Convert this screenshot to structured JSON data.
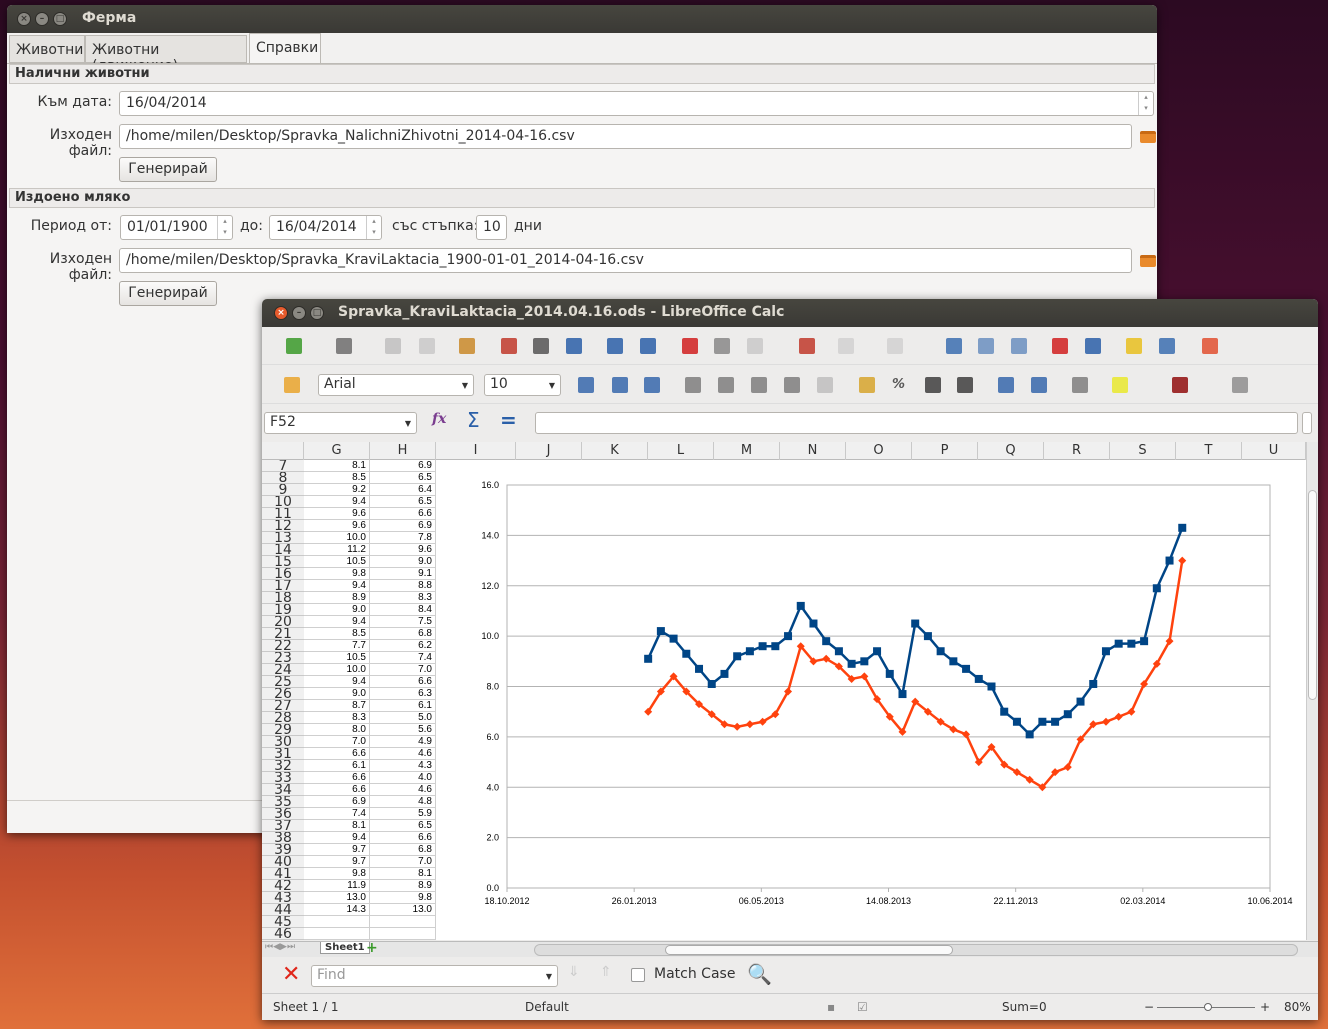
{
  "ferma": {
    "title": "Ферма",
    "tabs": [
      {
        "label": "Животни"
      },
      {
        "label": "Животни (движение)"
      },
      {
        "label": "Справки",
        "active": true
      }
    ],
    "available": {
      "header": "Налични животни",
      "date_label": "Към дата:",
      "date_value": "16/04/2014",
      "file_label": "Изходен файл:",
      "file_value": "/home/milen/Desktop/Spravka_NalichniZhivotni_2014-04-16.csv",
      "generate_label": "Генерирай"
    },
    "milk": {
      "header": "Издоено мляко",
      "period_label": "Период  от:",
      "from_value": "01/01/1900",
      "to_label": "до:",
      "to_value": "16/04/2014",
      "step_label": "със стъпка:",
      "step_value": "10",
      "days_label": "дни",
      "file_label": "Изходен файл:",
      "file_value": "/home/milen/Desktop/Spravka_KraviLaktacia_1900-01-01_2014-04-16.csv",
      "generate_label": "Генерирай"
    }
  },
  "calc": {
    "title": "Spravka_KraviLaktacia_2014.04.16.ods - LibreOffice Calc",
    "toolbar1_icons": [
      "new-spreadsheet-icon",
      "open-folder-icon",
      "save-icon",
      "email-icon",
      "edit-mode-icon",
      "export-pdf-icon",
      "print-icon",
      "print-preview-icon",
      "spellcheck-icon",
      "autospellcheck-icon",
      "cut-icon",
      "copy-icon",
      "paste-icon",
      "clone-formatting-icon",
      "undo-icon",
      "redo-icon",
      "hyperlink-icon",
      "sort-ascending-icon",
      "sort-descending-icon",
      "insert-chart-icon",
      "show-draw-functions-icon",
      "navigator-icon",
      "gallery-icon",
      "help-icon"
    ],
    "toolbar2_icons": [
      "styles-icon",
      "bold-icon",
      "italic-icon",
      "underline-icon",
      "align-left-icon",
      "align-center-icon",
      "align-right-icon",
      "justify-icon",
      "merge-cells-icon",
      "currency-icon",
      "percent-icon",
      "add-decimal-icon",
      "delete-decimal-icon",
      "decrease-indent-icon",
      "increase-indent-icon",
      "borders-icon",
      "background-color-icon",
      "font-color-icon",
      "toggle-grid-icon"
    ],
    "font_name": "Arial",
    "font_size": "10",
    "percent_label": "%",
    "name_box": "F52",
    "formula_value": "",
    "columns": [
      "G",
      "H",
      "I",
      "J",
      "K",
      "L",
      "M",
      "N",
      "O",
      "P",
      "Q",
      "R",
      "S",
      "T",
      "U"
    ],
    "rows": [
      7,
      8,
      9,
      10,
      11,
      12,
      13,
      14,
      15,
      16,
      17,
      18,
      19,
      20,
      21,
      22,
      23,
      24,
      25,
      26,
      27,
      28,
      29,
      30,
      31,
      32,
      33,
      34,
      35,
      36,
      37,
      38,
      39,
      40,
      41,
      42,
      43,
      44,
      45,
      46
    ],
    "col_g": [
      "8.1",
      "8.5",
      "9.2",
      "9.4",
      "9.6",
      "9.6",
      "10.0",
      "11.2",
      "10.5",
      "9.8",
      "9.4",
      "8.9",
      "9.0",
      "9.4",
      "8.5",
      "7.7",
      "10.5",
      "10.0",
      "9.4",
      "9.0",
      "8.7",
      "8.3",
      "8.0",
      "7.0",
      "6.6",
      "6.1",
      "6.6",
      "6.6",
      "6.9",
      "7.4",
      "8.1",
      "9.4",
      "9.7",
      "9.7",
      "9.8",
      "11.9",
      "13.0",
      "14.3"
    ],
    "col_h": [
      "6.9",
      "6.5",
      "6.4",
      "6.5",
      "6.6",
      "6.9",
      "7.8",
      "9.6",
      "9.0",
      "9.1",
      "8.8",
      "8.3",
      "8.4",
      "7.5",
      "6.8",
      "6.2",
      "7.4",
      "7.0",
      "6.6",
      "6.3",
      "6.1",
      "5.0",
      "5.6",
      "4.9",
      "4.6",
      "4.3",
      "4.0",
      "4.6",
      "4.8",
      "5.9",
      "6.5",
      "6.6",
      "6.8",
      "7.0",
      "8.1",
      "8.9",
      "9.8",
      "13.0"
    ],
    "sheet_tab": "Sheet1",
    "find_placeholder": "Find",
    "match_case_label": "Match Case",
    "match_case_checked": false,
    "status": {
      "sheet": "Sheet 1 / 1",
      "style": "Default",
      "sum": "Sum=0",
      "zoom": "80%",
      "zoom_level": 80
    }
  },
  "chart_data": {
    "type": "line",
    "x_start_date": "06.02.2013",
    "x_step_days": 10,
    "x_axis_start": "18.10.2012",
    "xlim_days": [
      0,
      600
    ],
    "x_tick_labels": [
      "18.10.2012",
      "26.01.2013",
      "06.05.2013",
      "14.08.2013",
      "22.11.2013",
      "02.03.2014",
      "10.06.2014"
    ],
    "x_tick_step_days": 100,
    "ylim": [
      0,
      16
    ],
    "y_tick_labels": [
      "0.0",
      "2.0",
      "4.0",
      "6.0",
      "8.0",
      "10.0",
      "12.0",
      "14.0",
      "16.0"
    ],
    "grid": true,
    "legend": "none",
    "series": [
      {
        "name": "G",
        "color": "#004586",
        "marker": "square",
        "values": [
          9.1,
          10.2,
          9.9,
          9.3,
          8.7,
          8.1,
          8.5,
          9.2,
          9.4,
          9.6,
          9.6,
          10.0,
          11.2,
          10.5,
          9.8,
          9.4,
          8.9,
          9.0,
          9.4,
          8.5,
          7.7,
          10.5,
          10.0,
          9.4,
          9.0,
          8.7,
          8.3,
          8.0,
          7.0,
          6.6,
          6.1,
          6.6,
          6.6,
          6.9,
          7.4,
          8.1,
          9.4,
          9.7,
          9.7,
          9.8,
          11.9,
          13.0,
          14.3
        ]
      },
      {
        "name": "H",
        "color": "#ff420e",
        "marker": "diamond",
        "values": [
          7.0,
          7.8,
          8.4,
          7.8,
          7.3,
          6.9,
          6.5,
          6.4,
          6.5,
          6.6,
          6.9,
          7.8,
          9.6,
          9.0,
          9.1,
          8.8,
          8.3,
          8.4,
          7.5,
          6.8,
          6.2,
          7.4,
          7.0,
          6.6,
          6.3,
          6.1,
          5.0,
          5.6,
          4.9,
          4.6,
          4.3,
          4.0,
          4.6,
          4.8,
          5.9,
          6.5,
          6.6,
          6.8,
          7.0,
          8.1,
          8.9,
          9.8,
          13.0
        ]
      }
    ]
  }
}
